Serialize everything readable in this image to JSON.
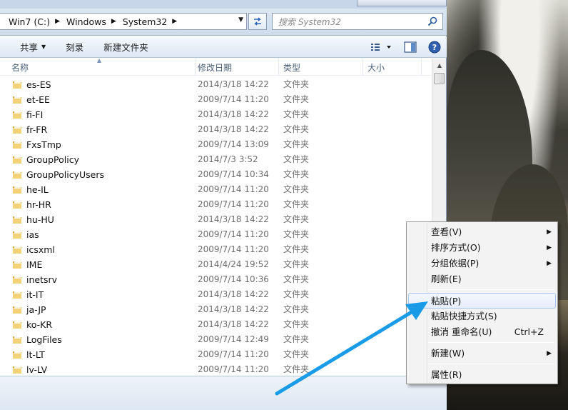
{
  "address": {
    "crumbs": [
      "Win7 (C:)",
      "Windows",
      "System32"
    ],
    "search_placeholder": "搜索 System32"
  },
  "toolbar": {
    "share_label": "共享",
    "burn_label": "刻录",
    "new_folder_label": "新建文件夹"
  },
  "columns": {
    "name": "名称",
    "date": "修改日期",
    "type": "类型",
    "size": "大小"
  },
  "files": [
    {
      "name": "es-ES",
      "date": "2014/3/18 14:22",
      "type": "文件夹"
    },
    {
      "name": "et-EE",
      "date": "2009/7/14 11:20",
      "type": "文件夹"
    },
    {
      "name": "fi-FI",
      "date": "2014/3/18 14:22",
      "type": "文件夹"
    },
    {
      "name": "fr-FR",
      "date": "2014/3/18 14:22",
      "type": "文件夹"
    },
    {
      "name": "FxsTmp",
      "date": "2009/7/14 13:09",
      "type": "文件夹"
    },
    {
      "name": "GroupPolicy",
      "date": "2014/7/3 3:52",
      "type": "文件夹"
    },
    {
      "name": "GroupPolicyUsers",
      "date": "2009/7/14 10:34",
      "type": "文件夹"
    },
    {
      "name": "he-IL",
      "date": "2009/7/14 11:20",
      "type": "文件夹"
    },
    {
      "name": "hr-HR",
      "date": "2009/7/14 11:20",
      "type": "文件夹"
    },
    {
      "name": "hu-HU",
      "date": "2014/3/18 14:22",
      "type": "文件夹"
    },
    {
      "name": "ias",
      "date": "2009/7/14 11:20",
      "type": "文件夹"
    },
    {
      "name": "icsxml",
      "date": "2009/7/14 11:20",
      "type": "文件夹"
    },
    {
      "name": "IME",
      "date": "2014/4/24 19:52",
      "type": "文件夹"
    },
    {
      "name": "inetsrv",
      "date": "2009/7/14 10:36",
      "type": "文件夹"
    },
    {
      "name": "it-IT",
      "date": "2014/3/18 14:22",
      "type": "文件夹"
    },
    {
      "name": "ja-JP",
      "date": "2014/3/18 14:22",
      "type": "文件夹"
    },
    {
      "name": "ko-KR",
      "date": "2014/3/18 14:22",
      "type": "文件夹"
    },
    {
      "name": "LogFiles",
      "date": "2009/7/14 12:49",
      "type": "文件夹"
    },
    {
      "name": "lt-LT",
      "date": "2009/7/14 11:20",
      "type": "文件夹"
    },
    {
      "name": "lv-LV",
      "date": "2009/7/14 11:20",
      "type": "文件夹"
    }
  ],
  "context_menu": {
    "view": "查看(V)",
    "sort": "排序方式(O)",
    "group": "分组依据(P)",
    "refresh": "刷新(E)",
    "paste": "粘贴(P)",
    "paste_shortcut": "粘贴快捷方式(S)",
    "undo_rename": "撤消 重命名(U)",
    "undo_shortcut": "Ctrl+Z",
    "new": "新建(W)",
    "properties": "属性(R)"
  },
  "colors": {
    "annotation_arrow": "#1a9be8",
    "folder_yellow": "#e8c25a",
    "menu_highlight_border": "#a8c8f0"
  }
}
